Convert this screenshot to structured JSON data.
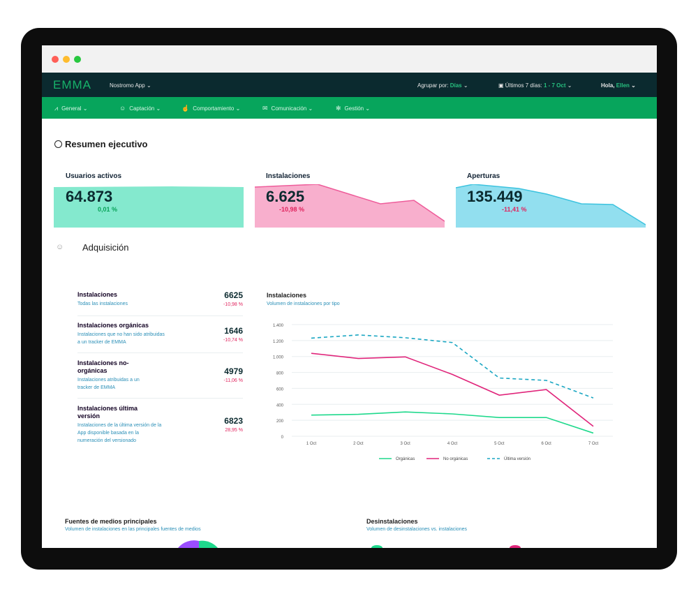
{
  "window": {
    "dots": [
      "#ff5f57",
      "#febc2e",
      "#28c840"
    ]
  },
  "topnav": {
    "logo": "EMMA",
    "app_name": "Nostromo App",
    "group_label": "Agrupar por:",
    "group_value": "Días",
    "range_label": "Últimos 7 días:",
    "range_value": "1 - 7 Oct",
    "greeting": "Hola,",
    "user": "Ellen"
  },
  "subnav": {
    "items": [
      {
        "label": "General",
        "icon": "chart-icon"
      },
      {
        "label": "Captación",
        "icon": "user-icon"
      },
      {
        "label": "Comportamiento",
        "icon": "hand-icon"
      },
      {
        "label": "Comunicación",
        "icon": "message-icon"
      },
      {
        "label": "Gestión",
        "icon": "gear-icon"
      }
    ]
  },
  "summary": {
    "title": "Resumen ejecutivo",
    "kpis": [
      {
        "label": "Usuarios activos",
        "value": "64.873",
        "delta": "0,01 %",
        "color": "#6ee5c5",
        "delta_color": "#0aa35a"
      },
      {
        "label": "Instalaciones",
        "value": "6.625",
        "delta": "-10,98 %",
        "color": "#f7a6c8",
        "delta_color": "#e0245e"
      },
      {
        "label": "Aperturas",
        "value": "135.449",
        "delta": "-11,41 %",
        "color": "#7fd9ec",
        "delta_color": "#e0245e"
      }
    ]
  },
  "acquisition": {
    "title": "Adquisición",
    "metrics": [
      {
        "title": "Instalaciones",
        "desc": "Todas las instalaciones",
        "value": "6625",
        "pct": "-10,98 %"
      },
      {
        "title": "Instalaciones orgánicas",
        "desc": "Instalaciones que no han sido atribuidas a un tracker de EMMA",
        "value": "1646",
        "pct": "-10,74 %"
      },
      {
        "title": "Instalaciones no-orgánicas",
        "desc": "Instalaciones atribuidas a un tracker de EMMA",
        "value": "4979",
        "pct": "-11,06 %"
      },
      {
        "title": "Instalaciones última versión",
        "desc": "Instalaciones de la última versión de la App disponible basada en la numeración del versionado",
        "value": "6823",
        "pct": "28,95 %"
      }
    ]
  },
  "chart_data": {
    "type": "line",
    "title": "Instalaciones",
    "subtitle": "Volumen de instalaciones por tipo",
    "categories": [
      "1 Oct",
      "2 Oct",
      "3 Oct",
      "4 Oct",
      "5 Oct",
      "6 Oct",
      "7 Oct"
    ],
    "ylim": [
      0,
      1400
    ],
    "yticks": [
      "0",
      "200",
      "400",
      "600",
      "800",
      "1.000",
      "1.200",
      "1.400"
    ],
    "series": [
      {
        "name": "Orgánicas",
        "color": "#1ed98c",
        "dash": false,
        "values": [
          265,
          275,
          305,
          280,
          235,
          235,
          40
        ]
      },
      {
        "name": "No orgánicas",
        "color": "#e0247a",
        "dash": false,
        "values": [
          1040,
          975,
          995,
          775,
          515,
          585,
          125
        ]
      },
      {
        "name": "Última versión",
        "color": "#19a6c2",
        "dash": true,
        "values": [
          1230,
          1270,
          1235,
          1175,
          730,
          700,
          480
        ]
      }
    ]
  },
  "bottom": {
    "left_title": "Fuentes de medios principales",
    "left_sub": "Volumen de instalaciones en las principales fuentes de medios",
    "right_title": "Desinstalaciones",
    "right_sub": "Volumen de desinstalaciones vs. instalaciones"
  }
}
